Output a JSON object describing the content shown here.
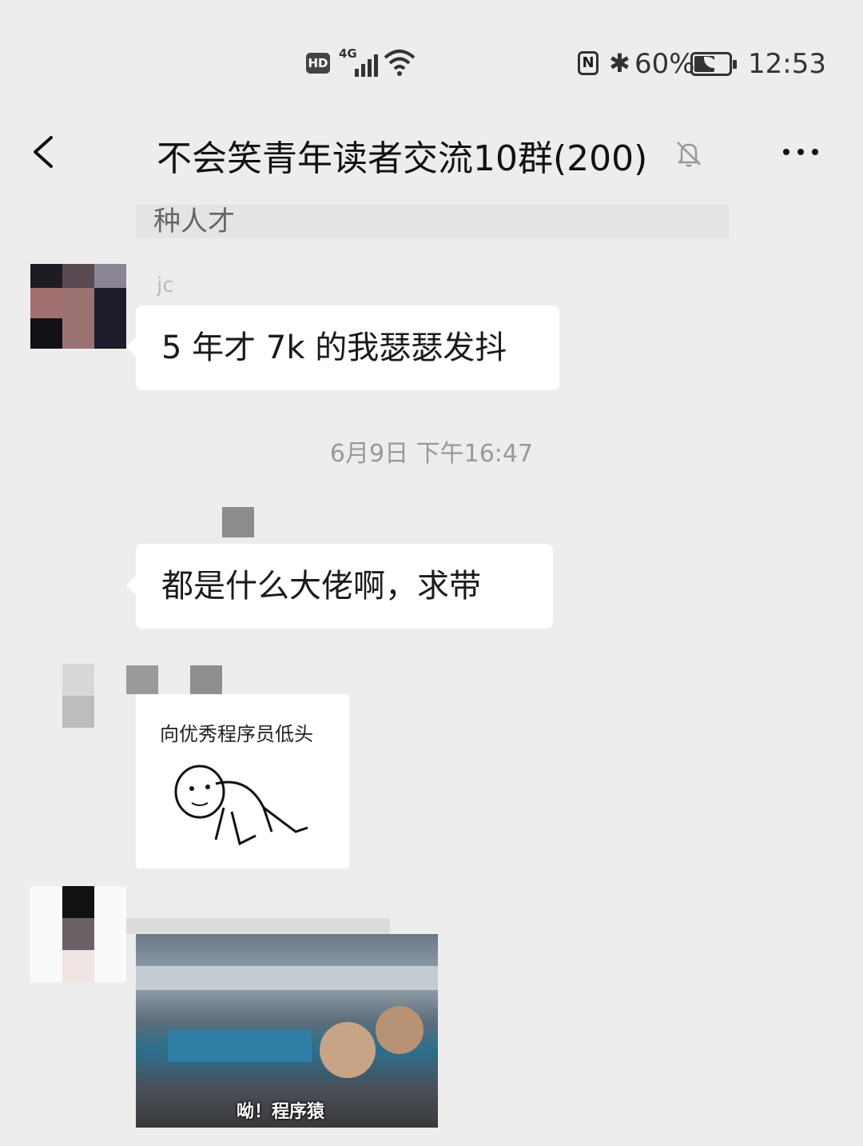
{
  "status_bar": {
    "hd": "HD",
    "network": "4G",
    "nfc": "N",
    "battery_percent": "60%",
    "battery_level": 0.6,
    "time": "12:53"
  },
  "header": {
    "title": "不会笑青年读者交流10群(200)",
    "icons": [
      "back-icon",
      "mute-bell-icon",
      "more-icon"
    ]
  },
  "messages": {
    "prev_fragment": "种人才",
    "msg1": {
      "sender_partial": "jc",
      "text": "5 年才 7k 的我瑟瑟发抖"
    },
    "timestamp": "6月9日 下午16:47",
    "msg2": {
      "text": "都是什么大佬啊，求带"
    },
    "msg3": {
      "sticker_caption": "向优秀程序员低头"
    },
    "msg4": {
      "image_caption": "呦！程序猿"
    }
  }
}
